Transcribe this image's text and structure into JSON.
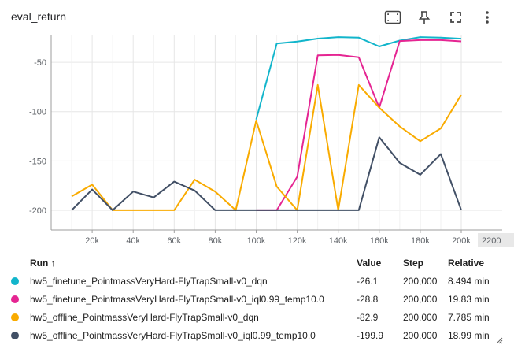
{
  "header": {
    "title": "eval_return"
  },
  "toolbar": [
    "fit-domain-icon",
    "pin-icon",
    "fullscreen-icon",
    "more-vert-icon"
  ],
  "colors": {
    "grid": "#e6e6e6",
    "axis": "#9e9e9e"
  },
  "chart_data": {
    "type": "line",
    "xlim": [
      0,
      200000
    ],
    "ylim": [
      -220,
      -22
    ],
    "x_ticks": [
      20000,
      40000,
      60000,
      80000,
      100000,
      120000,
      140000,
      160000,
      180000,
      200000
    ],
    "x_tick_labels": [
      "20k",
      "40k",
      "60k",
      "80k",
      "100k",
      "120k",
      "140k",
      "160k",
      "180k",
      "200k"
    ],
    "x_overflow_label": "2200",
    "y_ticks": [
      -50,
      -100,
      -150,
      -200
    ],
    "y_tick_labels": [
      "-50",
      "-100",
      "-150",
      "-200"
    ],
    "grid": true,
    "series": [
      {
        "name": "hw5_finetune_PointmassVeryHard-FlyTrapSmall-v0_dqn",
        "color": "#12b5cb",
        "x": [
          100000,
          110000,
          120000,
          130000,
          140000,
          150000,
          160000,
          170000,
          180000,
          190000,
          200000
        ],
        "y": [
          -108,
          -31,
          -29,
          -26,
          -24.5,
          -25,
          -34,
          -28,
          -24.5,
          -25,
          -26.1
        ]
      },
      {
        "name": "hw5_finetune_PointmassVeryHard-FlyTrapSmall-v0_iql0.99_temp10.0",
        "color": "#e52592",
        "x": [
          100000,
          110000,
          120000,
          130000,
          140000,
          150000,
          160000,
          170000,
          180000,
          190000,
          200000
        ],
        "y": [
          -200,
          -200,
          -166,
          -43,
          -42.5,
          -45,
          -96,
          -28.5,
          -27.5,
          -27.5,
          -28.8
        ]
      },
      {
        "name": "hw5_offline_PointmassVeryHard-FlyTrapSmall-v0_dqn",
        "color": "#f9ab00",
        "x": [
          10000,
          20000,
          30000,
          40000,
          50000,
          60000,
          70000,
          80000,
          90000,
          100000,
          110000,
          120000,
          130000,
          140000,
          150000,
          160000,
          170000,
          180000,
          190000,
          200000
        ],
        "y": [
          -186,
          -174,
          -200,
          -200,
          -200,
          -200,
          -169,
          -181,
          -200,
          -109,
          -176,
          -200,
          -73,
          -200,
          -73,
          -96,
          -115,
          -130,
          -117,
          -82.9
        ]
      },
      {
        "name": "hw5_offline_PointmassVeryHard-FlyTrapSmall-v0_iql0.99_temp10.0",
        "color": "#425066",
        "x": [
          10000,
          20000,
          30000,
          40000,
          50000,
          60000,
          70000,
          80000,
          90000,
          100000,
          110000,
          120000,
          130000,
          140000,
          150000,
          160000,
          170000,
          180000,
          190000,
          200000
        ],
        "y": [
          -200,
          -179,
          -200,
          -181,
          -187,
          -171,
          -180,
          -200,
          -200,
          -200,
          -200,
          -200,
          -200,
          -200,
          -200,
          -126,
          -152,
          -164,
          -143,
          -199.9
        ]
      }
    ]
  },
  "table": {
    "headers": {
      "run": "Run ↑",
      "value": "Value",
      "step": "Step",
      "relative": "Relative"
    },
    "rows": [
      {
        "name": "hw5_finetune_PointmassVeryHard-FlyTrapSmall-v0_dqn",
        "color": "#12b5cb",
        "value": "-26.1",
        "step": "200,000",
        "relative": "8.494 min"
      },
      {
        "name": "hw5_finetune_PointmassVeryHard-FlyTrapSmall-v0_iql0.99_temp10.0",
        "color": "#e52592",
        "value": "-28.8",
        "step": "200,000",
        "relative": "19.83 min"
      },
      {
        "name": "hw5_offline_PointmassVeryHard-FlyTrapSmall-v0_dqn",
        "color": "#f9ab00",
        "value": "-82.9",
        "step": "200,000",
        "relative": "7.785 min"
      },
      {
        "name": "hw5_offline_PointmassVeryHard-FlyTrapSmall-v0_iql0.99_temp10.0",
        "color": "#425066",
        "value": "-199.9",
        "step": "200,000",
        "relative": "18.99 min"
      }
    ]
  }
}
